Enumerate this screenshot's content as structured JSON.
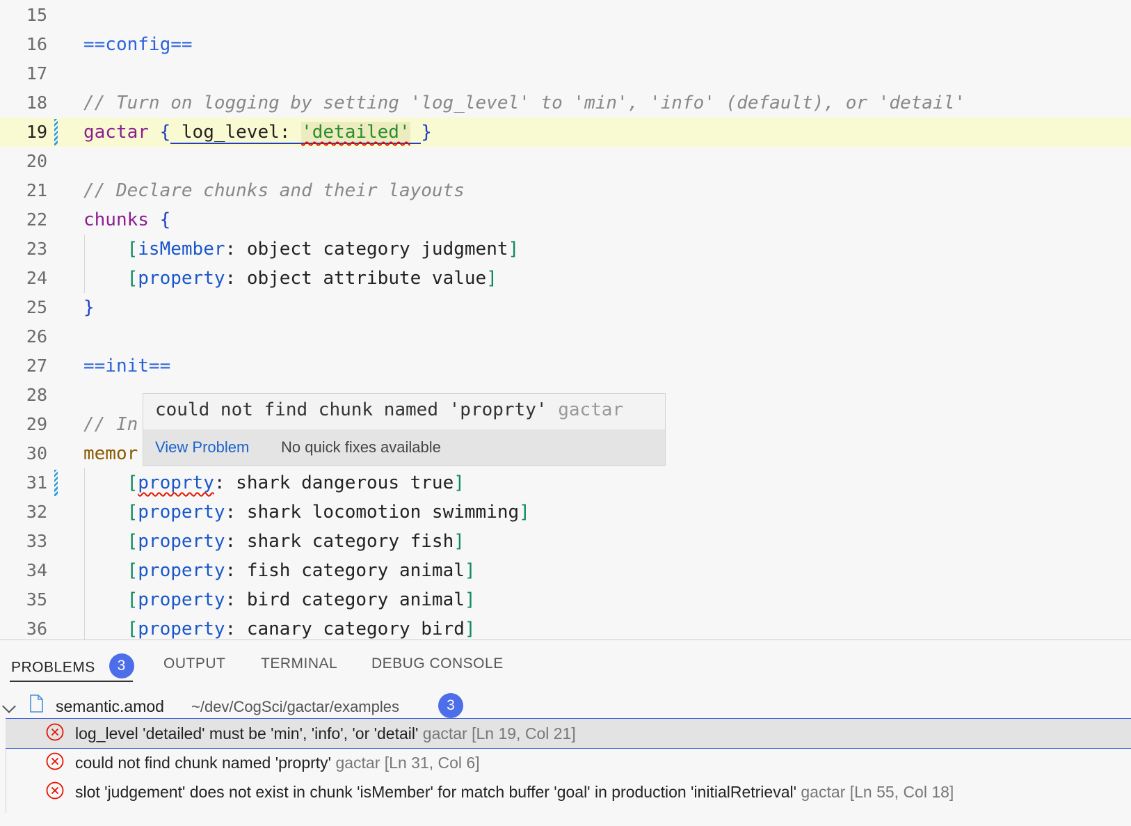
{
  "editor": {
    "lines": [
      {
        "n": "15",
        "tokens": []
      },
      {
        "n": "16",
        "tokens": [
          {
            "t": "==config==",
            "c": "t-sec"
          }
        ]
      },
      {
        "n": "17",
        "tokens": []
      },
      {
        "n": "18",
        "tokens": [
          {
            "t": "// Turn on logging by setting 'log_level' to 'min', 'info' (default), or 'detail'",
            "c": "t-cm"
          }
        ]
      },
      {
        "n": "19",
        "tokens": [
          {
            "t": "gactar",
            "c": "t-kw"
          },
          {
            "t": " ",
            "c": "t-plain"
          },
          {
            "t": "{",
            "c": "t-br"
          },
          {
            "t": " log_level: ",
            "c": "t-plain bracket-ul"
          },
          {
            "t": "'detailed'",
            "c": "t-str squig hl-str bracket-ul"
          },
          {
            "t": " ",
            "c": "t-plain bracket-ul"
          },
          {
            "t": "}",
            "c": "t-br"
          }
        ]
      },
      {
        "n": "20",
        "tokens": []
      },
      {
        "n": "21",
        "tokens": [
          {
            "t": "// Declare chunks and their layouts",
            "c": "t-cm"
          }
        ]
      },
      {
        "n": "22",
        "tokens": [
          {
            "t": "chunks",
            "c": "t-kw"
          },
          {
            "t": " ",
            "c": "t-plain"
          },
          {
            "t": "{",
            "c": "t-br"
          }
        ]
      },
      {
        "n": "23",
        "tokens": [
          {
            "t": "    ",
            "c": "t-plain"
          },
          {
            "t": "[",
            "c": "t-sq"
          },
          {
            "t": "isMember",
            "c": "t-key"
          },
          {
            "t": ": object category judgment",
            "c": "t-plain"
          },
          {
            "t": "]",
            "c": "t-sq"
          }
        ]
      },
      {
        "n": "24",
        "tokens": [
          {
            "t": "    ",
            "c": "t-plain"
          },
          {
            "t": "[",
            "c": "t-sq"
          },
          {
            "t": "property",
            "c": "t-key"
          },
          {
            "t": ": object attribute value",
            "c": "t-plain"
          },
          {
            "t": "]",
            "c": "t-sq"
          }
        ]
      },
      {
        "n": "25",
        "tokens": [
          {
            "t": "}",
            "c": "t-br"
          }
        ]
      },
      {
        "n": "26",
        "tokens": []
      },
      {
        "n": "27",
        "tokens": [
          {
            "t": "==init==",
            "c": "t-sec"
          }
        ]
      },
      {
        "n": "28",
        "tokens": []
      },
      {
        "n": "29",
        "tokens": [
          {
            "t": "// In",
            "c": "t-cm"
          }
        ]
      },
      {
        "n": "30",
        "tokens": [
          {
            "t": "memor",
            "c": "t-kw2"
          }
        ]
      },
      {
        "n": "31",
        "tokens": [
          {
            "t": "    ",
            "c": "t-plain"
          },
          {
            "t": "[",
            "c": "t-sq"
          },
          {
            "t": "proprty",
            "c": "t-key squig"
          },
          {
            "t": ": shark dangerous true",
            "c": "t-plain"
          },
          {
            "t": "]",
            "c": "t-sq"
          }
        ]
      },
      {
        "n": "32",
        "tokens": [
          {
            "t": "    ",
            "c": "t-plain"
          },
          {
            "t": "[",
            "c": "t-sq"
          },
          {
            "t": "property",
            "c": "t-key"
          },
          {
            "t": ": shark locomotion swimming",
            "c": "t-plain"
          },
          {
            "t": "]",
            "c": "t-sq"
          }
        ]
      },
      {
        "n": "33",
        "tokens": [
          {
            "t": "    ",
            "c": "t-plain"
          },
          {
            "t": "[",
            "c": "t-sq"
          },
          {
            "t": "property",
            "c": "t-key"
          },
          {
            "t": ": shark category fish",
            "c": "t-plain"
          },
          {
            "t": "]",
            "c": "t-sq"
          }
        ]
      },
      {
        "n": "34",
        "tokens": [
          {
            "t": "    ",
            "c": "t-plain"
          },
          {
            "t": "[",
            "c": "t-sq"
          },
          {
            "t": "property",
            "c": "t-key"
          },
          {
            "t": ": fish category animal",
            "c": "t-plain"
          },
          {
            "t": "]",
            "c": "t-sq"
          }
        ]
      },
      {
        "n": "35",
        "tokens": [
          {
            "t": "    ",
            "c": "t-plain"
          },
          {
            "t": "[",
            "c": "t-sq"
          },
          {
            "t": "property",
            "c": "t-key"
          },
          {
            "t": ": bird category animal",
            "c": "t-plain"
          },
          {
            "t": "]",
            "c": "t-sq"
          }
        ]
      },
      {
        "n": "36",
        "tokens": [
          {
            "t": "    ",
            "c": "t-plain"
          },
          {
            "t": "[",
            "c": "t-sq"
          },
          {
            "t": "property",
            "c": "t-key"
          },
          {
            "t": ": canary category bird",
            "c": "t-plain"
          },
          {
            "t": "]",
            "c": "t-sq"
          }
        ]
      }
    ],
    "current_line": "19",
    "dirty_lines": [
      "19",
      "31"
    ]
  },
  "hover": {
    "message": "could not find chunk named 'proprty' ",
    "source": "gactar",
    "view_problem": "View Problem",
    "no_fixes": "No quick fixes available"
  },
  "panel": {
    "tabs": [
      {
        "label": "PROBLEMS",
        "badge": "3",
        "active": true
      },
      {
        "label": "OUTPUT"
      },
      {
        "label": "TERMINAL"
      },
      {
        "label": "DEBUG CONSOLE"
      }
    ],
    "file": {
      "name": "semantic.amod",
      "path": "~/dev/CogSci/gactar/examples",
      "count": "3"
    },
    "problems": [
      {
        "message": "log_level 'detailed' must be 'min', 'info', 'or 'detail'",
        "source": "gactar",
        "location": "[Ln 19, Col 21]",
        "selected": true
      },
      {
        "message": "could not find chunk named 'proprty'",
        "source": "gactar",
        "location": "[Ln 31, Col 6]"
      },
      {
        "message": "slot 'judgement' does not exist in chunk 'isMember' for match buffer 'goal' in production 'initialRetrieval'",
        "source": "gactar",
        "location": "[Ln 55, Col 18]"
      }
    ]
  },
  "colors": {
    "accent": "#4c6ee8",
    "error": "#e51400",
    "current_line": "#fafad2"
  },
  "icons": {
    "error": "error-circle-icon",
    "file": "file-icon",
    "chevron": "chevron-down-icon"
  }
}
